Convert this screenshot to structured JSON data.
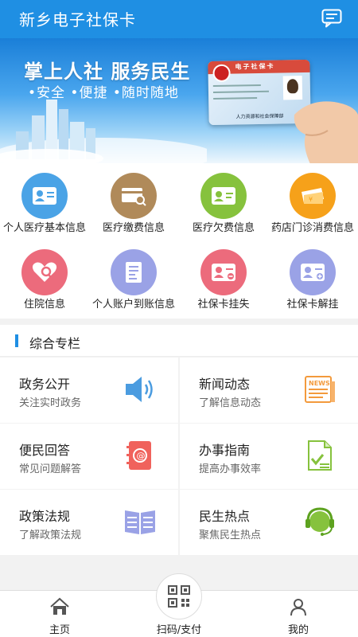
{
  "header": {
    "title": "新乡电子社保卡",
    "message_icon": "message-icon"
  },
  "banner": {
    "headline": "掌上人社  服务民生",
    "subline": "•安全  •便捷  •随时随地",
    "card_title": "电子社保卡",
    "card_footer": "人力资源和社会保障部"
  },
  "services": [
    {
      "label": "个人医疗基本信息",
      "icon": "medical-card-icon",
      "color": "#4aa3e6"
    },
    {
      "label": "医疗缴费信息",
      "icon": "payment-search-icon",
      "color": "#b08a5a"
    },
    {
      "label": "医疗欠费信息",
      "icon": "arrears-card-icon",
      "color": "#86c23d"
    },
    {
      "label": "药店门诊消费信息",
      "icon": "pharmacy-ticket-icon",
      "color": "#f6a11a"
    },
    {
      "label": "住院信息",
      "icon": "hospital-search-icon",
      "color": "#ec6b7c"
    },
    {
      "label": "个人账户到账信息",
      "icon": "account-document-icon",
      "color": "#9aa2e6"
    },
    {
      "label": "社保卡挂失",
      "icon": "card-lost-icon",
      "color": "#ec6b7c"
    },
    {
      "label": "社保卡解挂",
      "icon": "card-unlock-icon",
      "color": "#9aa2e6"
    }
  ],
  "section": {
    "title": "综合专栏"
  },
  "tiles": [
    {
      "title": "政务公开",
      "subtitle": "关注实时政务",
      "icon": "speaker-icon"
    },
    {
      "title": "新闻动态",
      "subtitle": "了解信息动态",
      "icon": "news-icon"
    },
    {
      "title": "便民回答",
      "subtitle": "常见问题解答",
      "icon": "contact-book-icon"
    },
    {
      "title": "办事指南",
      "subtitle": "提高办事效率",
      "icon": "checklist-document-icon"
    },
    {
      "title": "政策法规",
      "subtitle": "了解政策法规",
      "icon": "open-book-icon"
    },
    {
      "title": "民生热点",
      "subtitle": "聚焦民生热点",
      "icon": "headset-icon"
    }
  ],
  "nav": [
    {
      "label": "主页",
      "icon": "home-icon"
    },
    {
      "label": "扫码/支付",
      "icon": "qr-code-icon"
    },
    {
      "label": "我的",
      "icon": "user-icon"
    }
  ],
  "colors": {
    "primary": "#1f8fe3",
    "background": "#f2f2f2"
  }
}
